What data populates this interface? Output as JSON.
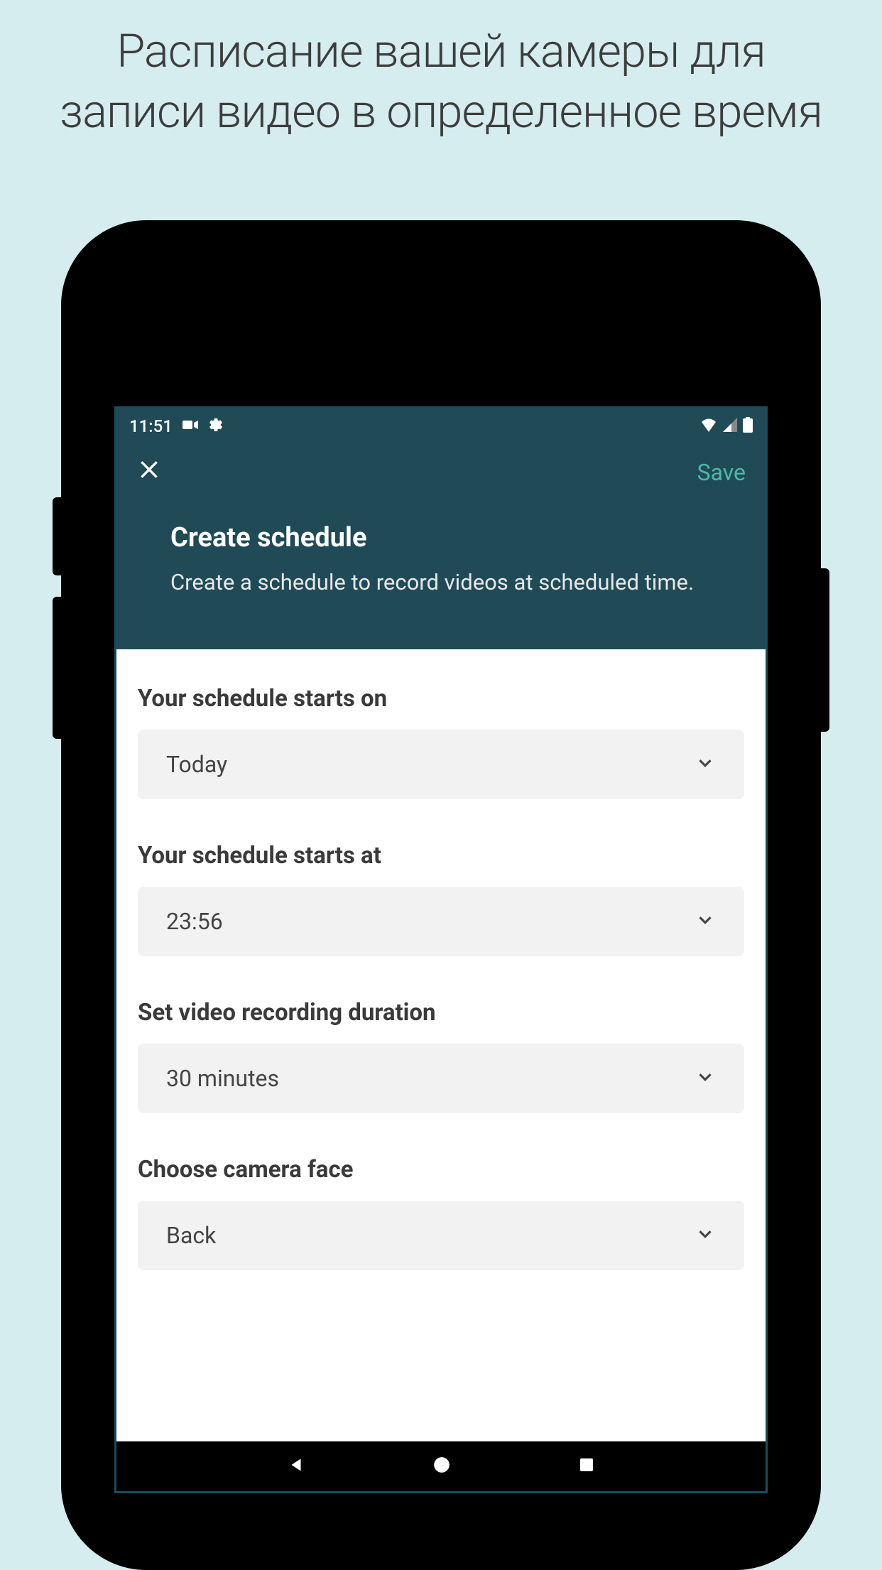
{
  "promo": {
    "title": "Расписание вашей камеры для записи видео в определенное время"
  },
  "statusBar": {
    "time": "11:51"
  },
  "appBar": {
    "saveLabel": "Save"
  },
  "header": {
    "title": "Create schedule",
    "subtitle": "Create a schedule to record videos at scheduled time."
  },
  "form": {
    "fields": [
      {
        "label": "Your schedule starts on",
        "value": "Today"
      },
      {
        "label": "Your schedule starts at",
        "value": "23:56"
      },
      {
        "label": "Set video recording duration",
        "value": "30 minutes"
      },
      {
        "label": "Choose camera face",
        "value": "Back"
      }
    ]
  }
}
